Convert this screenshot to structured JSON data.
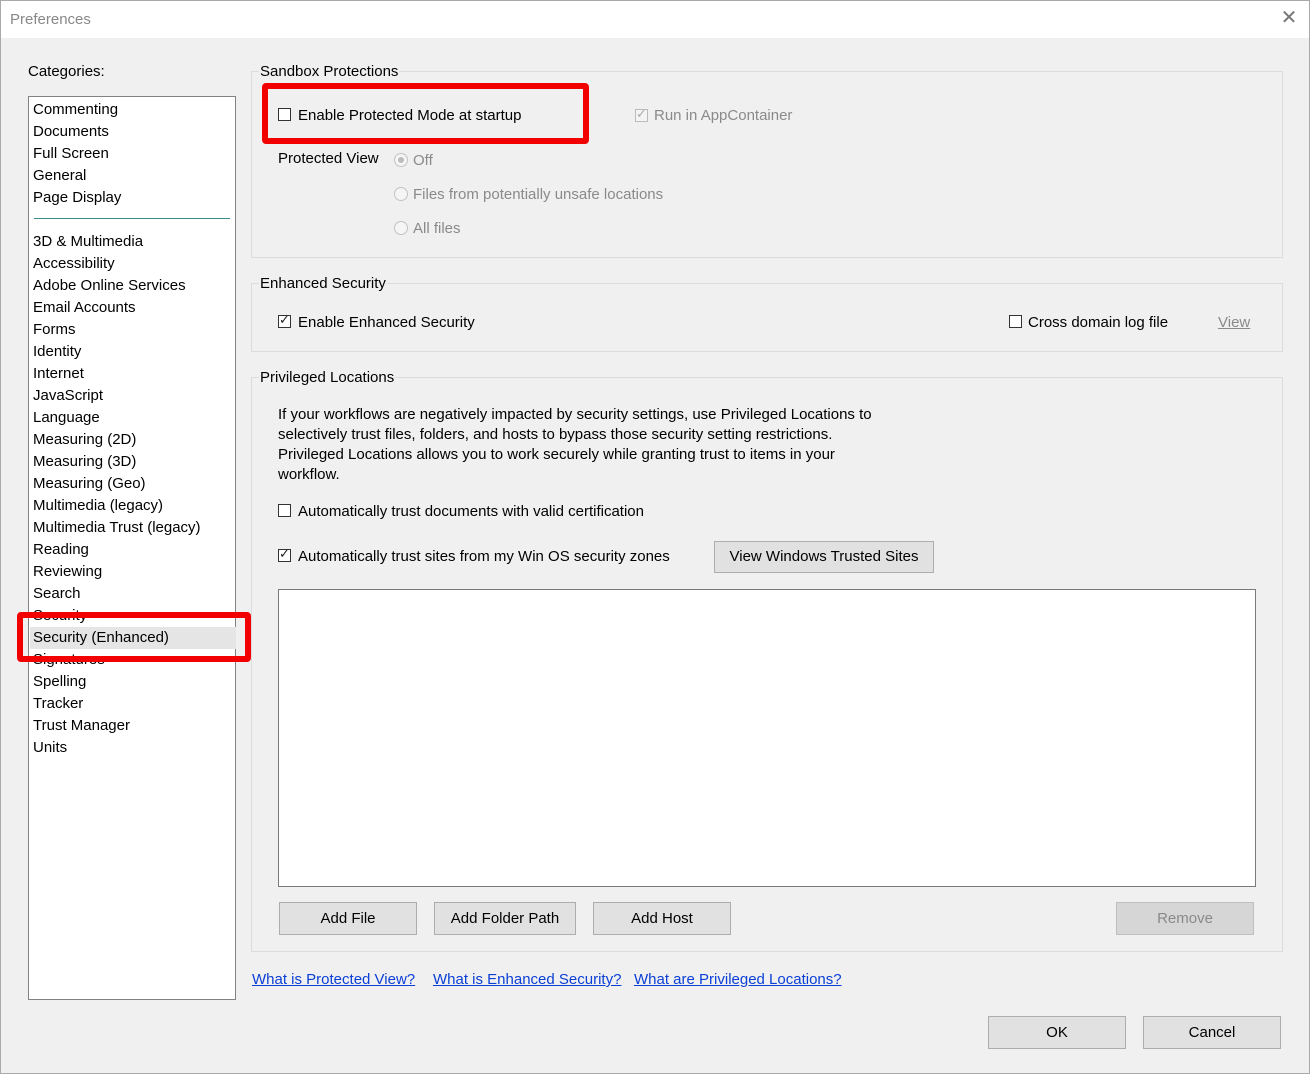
{
  "window": {
    "title": "Preferences",
    "close_glyph": "✕"
  },
  "categories": {
    "label": "Categories:",
    "top_items": [
      "Commenting",
      "Documents",
      "Full Screen",
      "General",
      "Page Display"
    ],
    "items": [
      "3D & Multimedia",
      "Accessibility",
      "Adobe Online Services",
      "Email Accounts",
      "Forms",
      "Identity",
      "Internet",
      "JavaScript",
      "Language",
      "Measuring (2D)",
      "Measuring (3D)",
      "Measuring (Geo)",
      "Multimedia (legacy)",
      "Multimedia Trust (legacy)",
      "Reading",
      "Reviewing",
      "Search",
      "Security",
      "Security (Enhanced)",
      "Signatures",
      "Spelling",
      "Tracker",
      "Trust Manager",
      "Units"
    ],
    "selected": "Security (Enhanced)"
  },
  "sandbox": {
    "legend": "Sandbox Protections",
    "protected_mode_label": "Enable Protected Mode at startup",
    "protected_mode_checked": false,
    "appcontainer_label": "Run in AppContainer",
    "appcontainer_checked": true,
    "protected_view_label": "Protected View",
    "options": [
      "Off",
      "Files from potentially unsafe locations",
      "All files"
    ],
    "selected_option": "Off"
  },
  "enhanced": {
    "legend": "Enhanced Security",
    "enable_label": "Enable Enhanced Security",
    "enable_checked": true,
    "cross_domain_label": "Cross domain log file",
    "cross_domain_checked": false,
    "view_link": "View"
  },
  "privileged": {
    "legend": "Privileged Locations",
    "description": [
      "If your workflows are negatively impacted by security settings, use Privileged Locations to",
      "selectively trust files, folders, and hosts to bypass those security setting restrictions.",
      "Privileged Locations allows you to work securely while granting trust to items in your",
      "workflow."
    ],
    "trust_cert_label": "Automatically trust documents with valid certification",
    "trust_cert_checked": false,
    "trust_sites_label": "Automatically trust sites from my Win OS security zones",
    "trust_sites_checked": true,
    "view_sites_button": "View Windows Trusted Sites",
    "add_file": "Add File",
    "add_folder": "Add Folder Path",
    "add_host": "Add Host",
    "remove": "Remove"
  },
  "links": {
    "protected_view": "What is Protected View?",
    "enhanced_security": "What is Enhanced Security?",
    "privileged_locations": "What are Privileged Locations?"
  },
  "footer": {
    "ok": "OK",
    "cancel": "Cancel"
  },
  "annotation_color": "#f20000"
}
